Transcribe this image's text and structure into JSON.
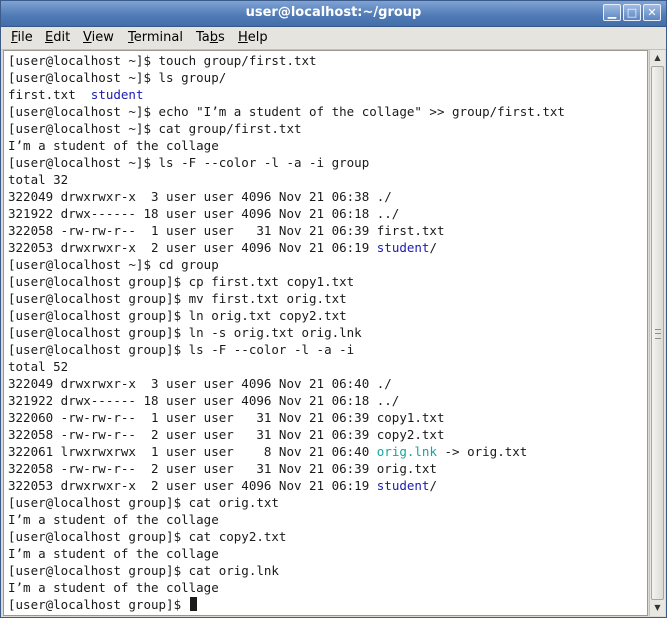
{
  "window": {
    "title": "user@localhost:~/group",
    "minimize_glyph": "▁",
    "maximize_glyph": "□",
    "close_glyph": "✕"
  },
  "menu": {
    "items": [
      {
        "pre": "",
        "u": "F",
        "post": "ile"
      },
      {
        "pre": "",
        "u": "E",
        "post": "dit"
      },
      {
        "pre": "",
        "u": "V",
        "post": "iew"
      },
      {
        "pre": "",
        "u": "T",
        "post": "erminal"
      },
      {
        "pre": "Ta",
        "u": "b",
        "post": "s"
      },
      {
        "pre": "",
        "u": "H",
        "post": "elp"
      }
    ]
  },
  "colors": {
    "directory": "#1a1ab2",
    "symlink": "#17a3a3",
    "titlebar": "#4f7ab5"
  },
  "terminal": {
    "lines": [
      [
        {
          "t": "[user@localhost ~]$ touch group/first.txt"
        }
      ],
      [
        {
          "t": "[user@localhost ~]$ ls group/"
        }
      ],
      [
        {
          "t": "first.txt  "
        },
        {
          "t": "student",
          "c": "dir"
        }
      ],
      [
        {
          "t": "[user@localhost ~]$ echo \"I’m a student of the collage\" >> group/first.txt"
        }
      ],
      [
        {
          "t": "[user@localhost ~]$ cat group/first.txt"
        }
      ],
      [
        {
          "t": "I’m a student of the collage"
        }
      ],
      [
        {
          "t": "[user@localhost ~]$ ls -F --color -l -a -i group"
        }
      ],
      [
        {
          "t": "total 32"
        }
      ],
      [
        {
          "t": "322049 drwxrwxr-x  3 user user 4096 Nov 21 06:38 ./"
        }
      ],
      [
        {
          "t": "321922 drwx------ 18 user user 4096 Nov 21 06:18 ../"
        }
      ],
      [
        {
          "t": "322058 -rw-rw-r--  1 user user   31 Nov 21 06:39 first.txt"
        }
      ],
      [
        {
          "t": "322053 drwxrwxr-x  2 user user 4096 Nov 21 06:19 "
        },
        {
          "t": "student",
          "c": "dir"
        },
        {
          "t": "/"
        }
      ],
      [
        {
          "t": "[user@localhost ~]$ cd group"
        }
      ],
      [
        {
          "t": "[user@localhost group]$ cp first.txt copy1.txt"
        }
      ],
      [
        {
          "t": "[user@localhost group]$ mv first.txt orig.txt"
        }
      ],
      [
        {
          "t": "[user@localhost group]$ ln orig.txt copy2.txt"
        }
      ],
      [
        {
          "t": "[user@localhost group]$ ln -s orig.txt orig.lnk"
        }
      ],
      [
        {
          "t": "[user@localhost group]$ ls -F --color -l -a -i"
        }
      ],
      [
        {
          "t": "total 52"
        }
      ],
      [
        {
          "t": "322049 drwxrwxr-x  3 user user 4096 Nov 21 06:40 ./"
        }
      ],
      [
        {
          "t": "321922 drwx------ 18 user user 4096 Nov 21 06:18 ../"
        }
      ],
      [
        {
          "t": "322060 -rw-rw-r--  1 user user   31 Nov 21 06:39 copy1.txt"
        }
      ],
      [
        {
          "t": "322058 -rw-rw-r--  2 user user   31 Nov 21 06:39 copy2.txt"
        }
      ],
      [
        {
          "t": "322061 lrwxrwxrwx  1 user user    8 Nov 21 06:40 "
        },
        {
          "t": "orig.lnk",
          "c": "link"
        },
        {
          "t": " -> orig.txt"
        }
      ],
      [
        {
          "t": "322058 -rw-rw-r--  2 user user   31 Nov 21 06:39 orig.txt"
        }
      ],
      [
        {
          "t": "322053 drwxrwxr-x  2 user user 4096 Nov 21 06:19 "
        },
        {
          "t": "student",
          "c": "dir"
        },
        {
          "t": "/"
        }
      ],
      [
        {
          "t": "[user@localhost group]$ cat orig.txt"
        }
      ],
      [
        {
          "t": "I’m a student of the collage"
        }
      ],
      [
        {
          "t": "[user@localhost group]$ cat copy2.txt"
        }
      ],
      [
        {
          "t": "I’m a student of the collage"
        }
      ],
      [
        {
          "t": "[user@localhost group]$ cat orig.lnk"
        }
      ],
      [
        {
          "t": "I’m a student of the collage"
        }
      ],
      [
        {
          "t": "[user@localhost group]$ "
        },
        {
          "cursor": true
        }
      ]
    ]
  },
  "scrollbar": {
    "up_glyph": "▲",
    "down_glyph": "▼"
  }
}
